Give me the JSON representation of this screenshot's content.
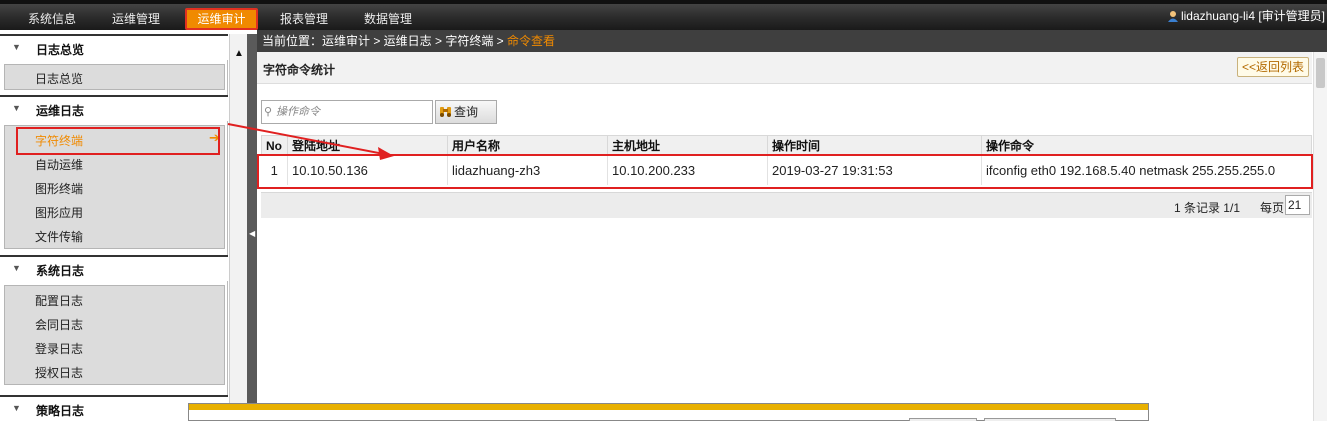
{
  "topnav": {
    "tabs": [
      "系统信息",
      "运维管理",
      "运维审计",
      "报表管理",
      "数据管理"
    ],
    "active_tab": "运维审计",
    "user": "lidazhuang-li4 [审计管理员]"
  },
  "sidebar": {
    "sections": [
      {
        "title": "日志总览",
        "items": [
          "日志总览"
        ]
      },
      {
        "title": "运维日志",
        "items": [
          "字符终端",
          "自动运维",
          "图形终端",
          "图形应用",
          "文件传输"
        ]
      },
      {
        "title": "系统日志",
        "items": [
          "配置日志",
          "会同日志",
          "登录日志",
          "授权日志"
        ]
      },
      {
        "title": "策略日志",
        "items": []
      }
    ],
    "active_item": "字符终端"
  },
  "breadcrumb": {
    "prefix": "当前位置：运维审计 > 运维日志 > 字符终端 > ",
    "current": "命令查看"
  },
  "panel": {
    "title": "字符命令统计",
    "back_label": "<<返回列表"
  },
  "search": {
    "placeholder": "操作命令",
    "button_label": "查询"
  },
  "table": {
    "headers": [
      "No",
      "登陆地址",
      "用户名称",
      "主机地址",
      "操作时间",
      "操作命令"
    ],
    "rows": [
      [
        "1",
        "10.10.50.136",
        "lidazhuang-zh3",
        "10.10.200.233",
        "2019-03-27 19:31:53",
        "ifconfig eth0 192.168.5.40 netmask 255.255.255.0"
      ]
    ]
  },
  "pager": {
    "info": "1 条记录 1/1",
    "per_page_label": "每页",
    "per_page_value": "21"
  },
  "colors": {
    "accent": "#f08a00",
    "annotation_red": "#e02020",
    "dialog_bar": "#e8b000"
  }
}
